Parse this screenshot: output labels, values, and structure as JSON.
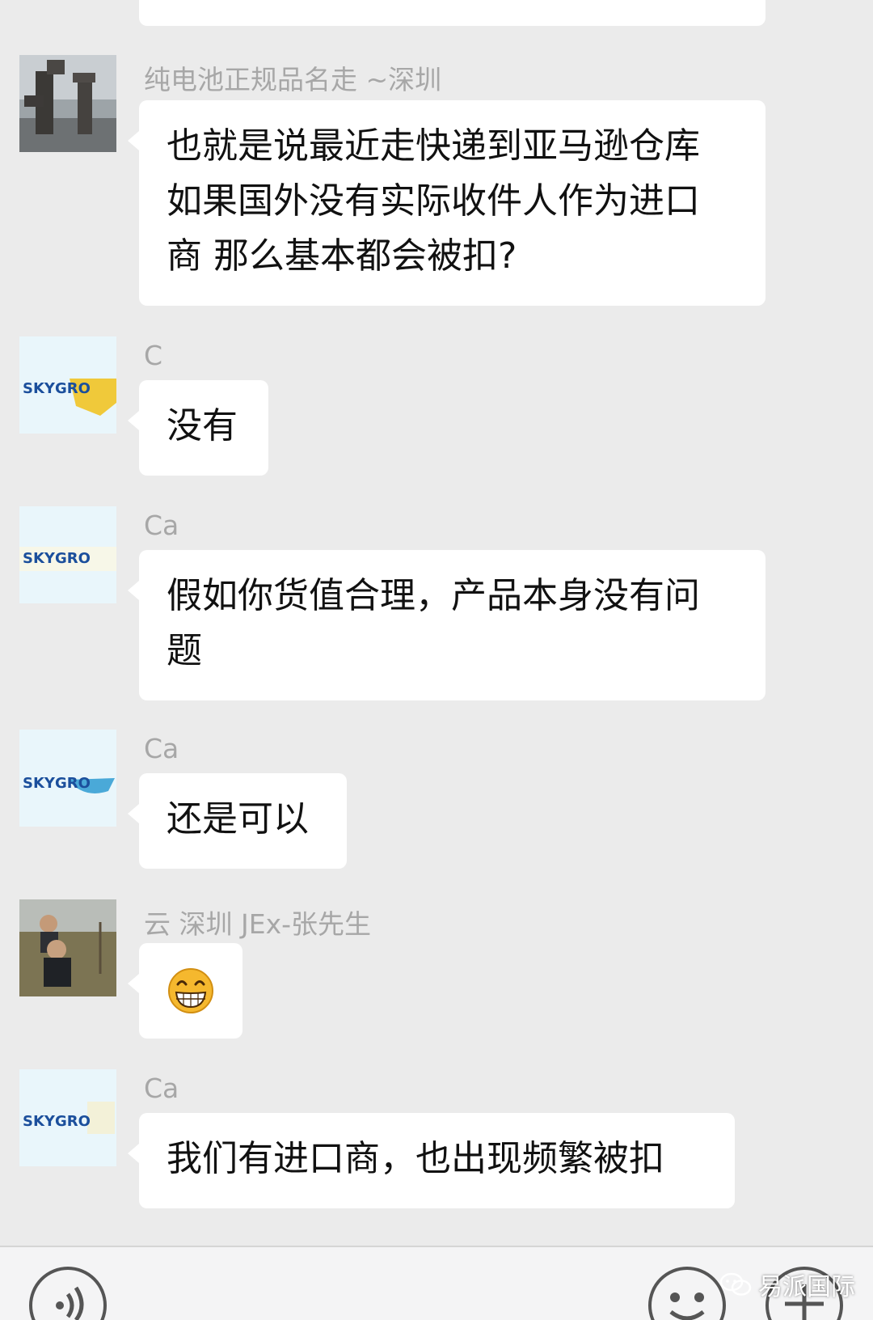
{
  "messages": [
    {
      "sender": "",
      "text": ""
    },
    {
      "sender": "纯电池正规品名走 ~深圳",
      "avatar": "stone-stack-photo-avatar",
      "text": "也就是说最近走快递到亚马逊仓库\n如果国外没有实际收件人作为进口\n商 那么基本都会被扣?"
    },
    {
      "sender": "C",
      "avatar": "skygroup-logo-avatar",
      "text": "没有"
    },
    {
      "sender": "Ca",
      "avatar": "skygroup-logo-avatar",
      "text": "假如你货值合理，产品本身没有问\n题"
    },
    {
      "sender": "Ca",
      "avatar": "skygroup-logo-avatar",
      "text": "还是可以"
    },
    {
      "sender": "云 深圳 JEx-张先生",
      "avatar": "father-child-photo-avatar",
      "emoji": "grinning-face-emoji"
    },
    {
      "sender": "Ca",
      "avatar": "skygroup-logo-avatar",
      "text": "我们有进口商，也出现频繁被扣"
    }
  ],
  "logos": {
    "skygroup_text": "SKYGRO"
  },
  "toolbar": {
    "voice_icon": "voice-icon",
    "emoji_icon": "emoji-icon",
    "add_icon": "plus-icon"
  },
  "watermark": {
    "icon": "wechat-icon",
    "text": "易派国际"
  },
  "colors": {
    "background": "#ebebeb",
    "bubble": "#ffffff",
    "sender_name": "#a7a7a7",
    "emoji_face": "#f5b82e"
  }
}
